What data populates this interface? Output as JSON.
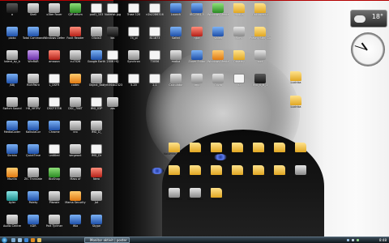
{
  "desktop": {
    "icons_left": [
      {
        "label": "o",
        "glyph": "g-dark"
      },
      {
        "label": "Shell",
        "glyph": "g-gray"
      },
      {
        "label": "o3ter Faxer",
        "glyph": "g-gray"
      },
      {
        "label": "QIP Infium",
        "glyph": "g-green"
      },
      {
        "label": "pod1_103",
        "glyph": "g-white"
      },
      {
        "label": "ploko",
        "glyph": "g-blue"
      },
      {
        "label": "Total Commander",
        "glyph": "g-blue"
      },
      {
        "label": "Windows Defender",
        "glyph": "g-gray"
      },
      {
        "label": "Foxit Reader",
        "glyph": "g-red"
      },
      {
        "label": "Olivia3",
        "glyph": "g-gray"
      },
      {
        "label": "talent_by_b",
        "glyph": "g-gray"
      },
      {
        "label": "WinRAR",
        "glyph": "g-purple"
      },
      {
        "label": "amazon",
        "glyph": "g-red"
      },
      {
        "label": "cu7026",
        "glyph": "g-gray"
      },
      {
        "label": "Google Earth",
        "glyph": "g-blue"
      },
      {
        "label": "JSBJ",
        "glyph": "g-blue"
      },
      {
        "label": "RichPaint",
        "glyph": "g-gray"
      },
      {
        "label": "L_DSFR",
        "glyph": "g-white"
      },
      {
        "label": "codec",
        "glyph": "g-orange"
      },
      {
        "label": "Object_Bar",
        "glyph": "g-gray"
      },
      {
        "label": "Switch Sound",
        "glyph": "g-gray"
      },
      {
        "label": "HB_5RTRV",
        "glyph": "g-gray"
      },
      {
        "label": "DSCF3756",
        "glyph": "g-white"
      },
      {
        "label": "DSC_7B6T",
        "glyph": "g-gray"
      },
      {
        "label": "IMG_03P",
        "glyph": "g-white"
      },
      {
        "label": "MediaCoder",
        "glyph": "g-blue"
      },
      {
        "label": "KalkulaCor",
        "glyph": "g-blue"
      },
      {
        "label": "Chrome",
        "glyph": "g-blue"
      },
      {
        "label": "nro",
        "glyph": "g-gray"
      },
      {
        "label": "IMG_D_",
        "glyph": "g-gray"
      },
      {
        "label": "Skrbka",
        "glyph": "g-blue"
      },
      {
        "label": "QuickTime",
        "glyph": "g-blue"
      },
      {
        "label": "untitled",
        "glyph": "g-white"
      },
      {
        "label": "sergeant",
        "glyph": "g-gray"
      },
      {
        "label": "IMG_Dr",
        "glyph": "g-white"
      },
      {
        "label": "Mozilla",
        "glyph": "g-orange"
      },
      {
        "label": "ZIC Translate",
        "glyph": "g-gray"
      },
      {
        "label": "BioShop",
        "glyph": "g-green"
      },
      {
        "label": "Mass of",
        "glyph": "g-gray"
      },
      {
        "label": "Nero",
        "glyph": "g-red"
      },
      {
        "label": "Ayler",
        "glyph": "g-teal"
      },
      {
        "label": "Poleky",
        "glyph": "g-blue"
      },
      {
        "label": "Pikowie",
        "glyph": "g-gray"
      },
      {
        "label": "Mama Security",
        "glyph": "g-orange"
      },
      {
        "label": "Jot",
        "glyph": "g-gray"
      },
      {
        "label": "Audio Centre",
        "glyph": "g-gray"
      },
      {
        "label": "KDR",
        "glyph": "g-blue"
      },
      {
        "label": "Part Tyrimer",
        "glyph": "g-gray"
      },
      {
        "label": "Wia",
        "glyph": "g-blue"
      },
      {
        "label": "Skype",
        "glyph": "g-blue"
      }
    ],
    "icons_center": [
      {
        "label": "Vodenst.jpg",
        "glyph": "g-white"
      },
      {
        "label": "Trose 120",
        "glyph": "g-white"
      },
      {
        "label": "n2b2286316",
        "glyph": "g-white"
      },
      {
        "label": "Launch",
        "glyph": "g-blue"
      },
      {
        "label": "IBC2564-5",
        "glyph": "g-blue"
      },
      {
        "label": "Windows Media Center",
        "glyph": "g-green"
      },
      {
        "label": "Hudba",
        "glyph": "g-folder"
      },
      {
        "label": "Dokumenty",
        "glyph": "g-folder"
      },
      {
        "label": "kai",
        "glyph": "g-dark"
      },
      {
        "label": "74_pl",
        "glyph": "g-white"
      },
      {
        "label": "811873",
        "glyph": "g-white"
      },
      {
        "label": "Safari",
        "glyph": "g-blue"
      },
      {
        "label": "njca",
        "glyph": "g-red"
      },
      {
        "label": "Videa",
        "glyph": "g-blue"
      },
      {
        "label": "Filmy",
        "glyph": "g-gray"
      },
      {
        "label": "Pracny Stlnj Clovelka",
        "glyph": "g-folder"
      },
      {
        "label": "2006 HQ",
        "glyph": "g-white"
      },
      {
        "label": "Synchron",
        "glyph": "g-gray"
      },
      {
        "label": "T0056",
        "glyph": "g-white"
      },
      {
        "label": "matka",
        "glyph": "g-gray"
      },
      {
        "label": "Zoner Editor",
        "glyph": "g-blue"
      },
      {
        "label": "Windows Media Player",
        "glyph": "g-orange"
      },
      {
        "label": "Obrazky",
        "glyph": "g-folder"
      },
      {
        "label": "sort",
        "glyph": "g-gray"
      },
      {
        "label": "Vyrichlob2323",
        "glyph": "g-white"
      },
      {
        "label": "5-20",
        "glyph": "g-white"
      },
      {
        "label": "2-1",
        "glyph": "g-white"
      },
      {
        "label": "Calculator",
        "glyph": "g-gray"
      },
      {
        "label": "tmp",
        "glyph": "g-gray"
      },
      {
        "label": "Olivia",
        "glyph": "g-gray"
      },
      {
        "label": "iu",
        "glyph": "g-white"
      },
      {
        "label": "IMG_0_B_1",
        "glyph": "g-dark"
      },
      {
        "label": "zas",
        "glyph": "g-gray"
      }
    ],
    "folders_right": [
      {
        "label": "Kolumne Plisek",
        "glyph": "g-folder"
      },
      {
        "label": "Beren Pivsky",
        "glyph": "g-folder"
      },
      {
        "label": "ESMS",
        "glyph": "g-folder"
      },
      {
        "label": "Nova slozka",
        "glyph": "g-folder"
      },
      {
        "label": "Nova slozka",
        "glyph": "g-folder"
      },
      {
        "label": "Dvinok Dzlio",
        "glyph": "g-folder"
      },
      {
        "label": "Brubo",
        "glyph": "g-folder"
      },
      {
        "label": "Humoranje",
        "glyph": "g-folder"
      },
      {
        "label": "Humoranje",
        "glyph": "g-folder"
      },
      {
        "label": "Humoranje",
        "glyph": "g-folder"
      },
      {
        "label": "Humoranje",
        "glyph": "g-folder"
      },
      {
        "label": "Humoranje",
        "glyph": "g-folder"
      },
      {
        "label": "Humoranje - Bring It On!",
        "glyph": "g-folder"
      },
      {
        "label": "Kompresion",
        "glyph": "g-gray"
      },
      {
        "label": "Kompresion",
        "glyph": "g-gray"
      },
      {
        "label": "Kompresion",
        "glyph": "g-gray"
      },
      {
        "label": "Kanda",
        "glyph": "g-folder"
      }
    ],
    "folders_far_right": [
      {
        "label": "Lucinka",
        "glyph": "g-folder"
      },
      {
        "label": "Lucinka",
        "glyph": "g-folder"
      }
    ]
  },
  "gadgets": {
    "weather": {
      "temp": "18°",
      "icon": "cloud-icon"
    },
    "clock": {
      "hour": 10,
      "minute": 48
    }
  },
  "taskbar": {
    "task_label": "Monitor aktivit | poster",
    "time": "8:48",
    "colors": {
      "bar": "#1d2a33",
      "start": "#1b6fb0"
    }
  }
}
